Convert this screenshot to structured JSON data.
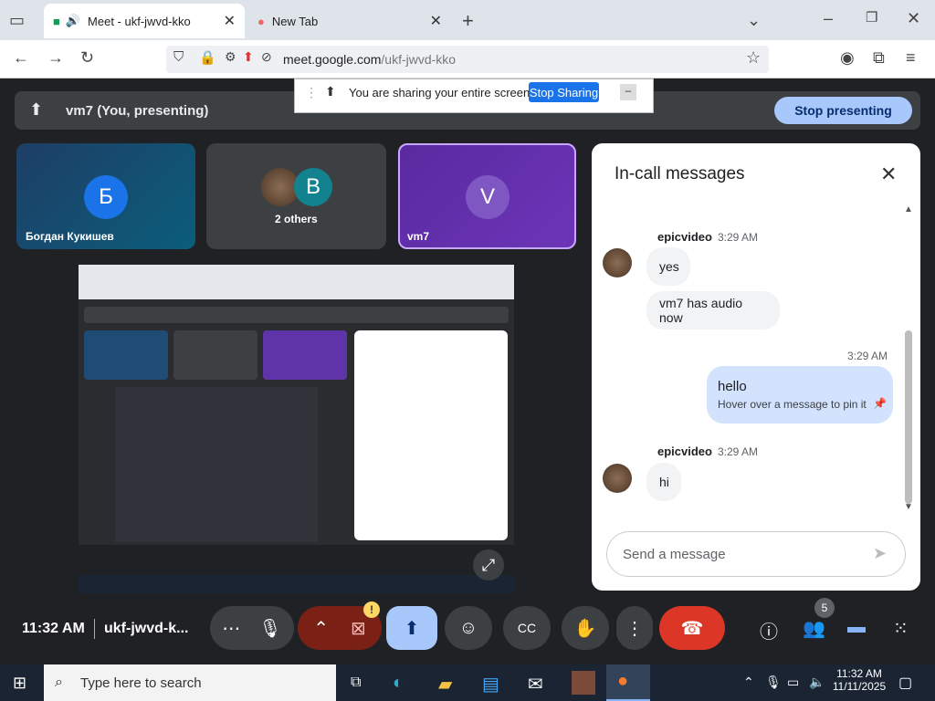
{
  "browser": {
    "tabs": [
      {
        "label": "Meet - ukf-jwvd-kko"
      },
      {
        "label": "New Tab"
      }
    ],
    "url_domain": "meet.google.com",
    "url_path": "/ukf-jwvd-kko"
  },
  "share_banner": {
    "text": "You are sharing your entire screen.",
    "stop_label": "Stop Sharing"
  },
  "presenting": {
    "label": "vm7 (You, presenting)",
    "stop_label": "Stop presenting"
  },
  "tiles": [
    {
      "initial": "Б",
      "name": "Богдан Кукишев"
    },
    {
      "initial": "B",
      "name": "2 others"
    },
    {
      "initial": "V",
      "name": "vm7"
    }
  ],
  "chat": {
    "title": "In-call messages",
    "messages": [
      {
        "sender": "epicvideo",
        "time": "3:29 AM",
        "lines": [
          "yes",
          "vm7 has audio now"
        ]
      },
      {
        "sender": "self",
        "time": "3:29 AM",
        "text": "hello",
        "hint": "Hover over a message to pin it"
      },
      {
        "sender": "epicvideo",
        "time": "3:29 AM",
        "lines": [
          "hi"
        ]
      }
    ],
    "input_placeholder": "Send a message"
  },
  "bottom": {
    "time": "11:32 AM",
    "meeting_code": "ukf-jwvd-k...",
    "people_count": "5"
  },
  "taskbar": {
    "search_placeholder": "Type here to search",
    "time": "11:32 AM",
    "date": "11/11/2025"
  },
  "colors": {
    "accent": "#a8c7fa",
    "end_call": "#dc3626",
    "share": "#8ab4f8"
  }
}
